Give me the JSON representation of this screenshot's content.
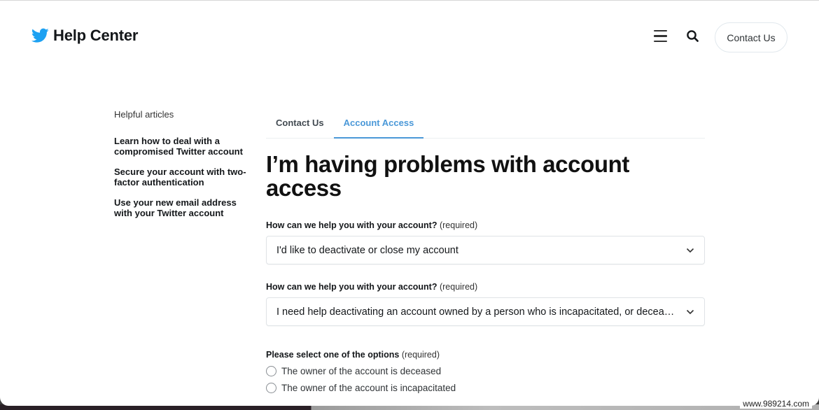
{
  "header": {
    "logo_icon": "twitter-bird-icon",
    "title": "Help Center",
    "menu_icon": "hamburger-menu-icon",
    "search_icon": "search-icon",
    "contact_button": "Contact Us"
  },
  "colors": {
    "brand": "#1da1f2",
    "tab_active": "#4a98d8",
    "text": "#14171a"
  },
  "sidebar": {
    "title": "Helpful articles",
    "items": [
      {
        "label": "Learn how to deal with a compromised Twitter account"
      },
      {
        "label": "Secure your account with two-factor authentication"
      },
      {
        "label": "Use your new email address with your Twitter account"
      }
    ]
  },
  "tabs": [
    {
      "label": "Contact Us",
      "active": false
    },
    {
      "label": "Account Access",
      "active": true
    }
  ],
  "main": {
    "title": "I’m having problems with account access",
    "fields": [
      {
        "label": "How can we help you with your account?",
        "required": "(required)",
        "value": "I'd like to deactivate or close my account"
      },
      {
        "label": "How can we help you with your account?",
        "required": "(required)",
        "value": "I need help deactivating an account owned by a person who is incapacitated, or deceased"
      }
    ],
    "radio_group": {
      "label": "Please select one of the options",
      "required": "(required)",
      "options": [
        {
          "label": "The owner of the account is deceased",
          "selected": false
        },
        {
          "label": "The owner of the account is incapacitated",
          "selected": false
        }
      ]
    }
  },
  "watermark": "www.989214.com"
}
